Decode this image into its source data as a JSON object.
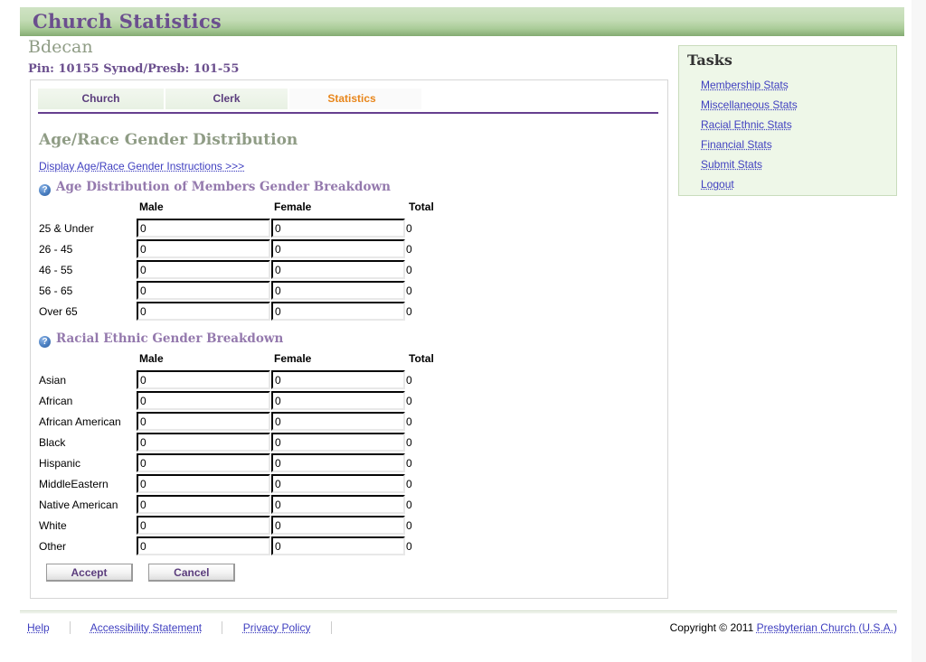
{
  "header": {
    "title": "Church Statistics",
    "church_name": "Bdecan",
    "pin_line": "Pin: 10155  Synod/Presb: 101-55"
  },
  "tabs": [
    {
      "label": "Church",
      "active": false
    },
    {
      "label": "Clerk",
      "active": false
    },
    {
      "label": "Statistics",
      "active": true
    }
  ],
  "main": {
    "section_title": "Age/Race Gender Distribution",
    "instructions_link": "Display Age/Race Gender Instructions >>>",
    "help_icon": "help-icon",
    "help_icon_glyph": "?",
    "age_section": {
      "heading": "Age Distribution of Members Gender Breakdown",
      "columns": [
        "Male",
        "Female",
        "Total"
      ],
      "rows": [
        {
          "label": "25 & Under",
          "male": "0",
          "female": "0",
          "total": "0"
        },
        {
          "label": "26 - 45",
          "male": "0",
          "female": "0",
          "total": "0"
        },
        {
          "label": "46 - 55",
          "male": "0",
          "female": "0",
          "total": "0"
        },
        {
          "label": "56 - 65",
          "male": "0",
          "female": "0",
          "total": "0"
        },
        {
          "label": "Over 65",
          "male": "0",
          "female": "0",
          "total": "0"
        }
      ]
    },
    "race_section": {
      "heading": "Racial Ethnic Gender Breakdown",
      "columns": [
        "Male",
        "Female",
        "Total"
      ],
      "rows": [
        {
          "label": "Asian",
          "male": "0",
          "female": "0",
          "total": "0"
        },
        {
          "label": "African",
          "male": "0",
          "female": "0",
          "total": "0"
        },
        {
          "label": "African American",
          "male": "0",
          "female": "0",
          "total": "0"
        },
        {
          "label": "Black",
          "male": "0",
          "female": "0",
          "total": "0"
        },
        {
          "label": "Hispanic",
          "male": "0",
          "female": "0",
          "total": "0"
        },
        {
          "label": "MiddleEastern",
          "male": "0",
          "female": "0",
          "total": "0"
        },
        {
          "label": "Native American",
          "male": "0",
          "female": "0",
          "total": "0"
        },
        {
          "label": "White",
          "male": "0",
          "female": "0",
          "total": "0"
        },
        {
          "label": "Other",
          "male": "0",
          "female": "0",
          "total": "0"
        }
      ]
    },
    "buttons": {
      "accept": "Accept",
      "cancel": "Cancel"
    }
  },
  "tasks": {
    "title": "Tasks",
    "items": [
      {
        "label": "Membership Stats"
      },
      {
        "label": "Miscellaneous Stats"
      },
      {
        "label": "Racial Ethnic Stats"
      },
      {
        "label": "Financial Stats"
      },
      {
        "label": "Submit Stats"
      },
      {
        "label": "Logout"
      }
    ]
  },
  "footer": {
    "links": [
      {
        "label": "Help"
      },
      {
        "label": "Accessibility Statement"
      },
      {
        "label": "Privacy Policy"
      }
    ],
    "copyright_prefix": "Copyright © 2011 ",
    "copyright_link": "Presbyterian Church (U.S.A.)"
  },
  "colors": {
    "header_green_light": "#cfe3c4",
    "header_green_dark": "#84ab72",
    "title_purple": "#6b4f8e",
    "heading_gray_green": "#8f9c85",
    "accent_orange": "#e8861b",
    "link_blue": "#4040c0",
    "tab_underline_purple": "#663f8f",
    "tasks_bg": "#eef7e8"
  }
}
